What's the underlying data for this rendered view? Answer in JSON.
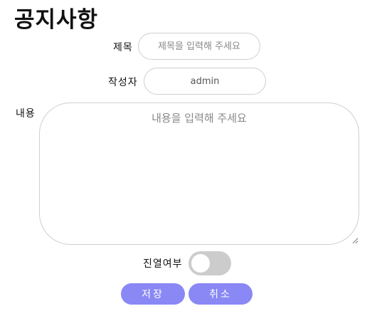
{
  "page": {
    "title": "공지사항"
  },
  "form": {
    "title_label": "제목",
    "title_placeholder": "제목을 입력해 주세요",
    "author_label": "작성자",
    "author_value": "admin",
    "content_label": "내용",
    "content_placeholder": "내용을 입력해 주세요",
    "display_label": "진열여부",
    "display_enabled": false
  },
  "actions": {
    "save_label": "저장",
    "cancel_label": "취소"
  },
  "colors": {
    "button_bg": "#8a88f5",
    "toggle_off": "#cccccc",
    "input_border": "#cfcfcf"
  }
}
